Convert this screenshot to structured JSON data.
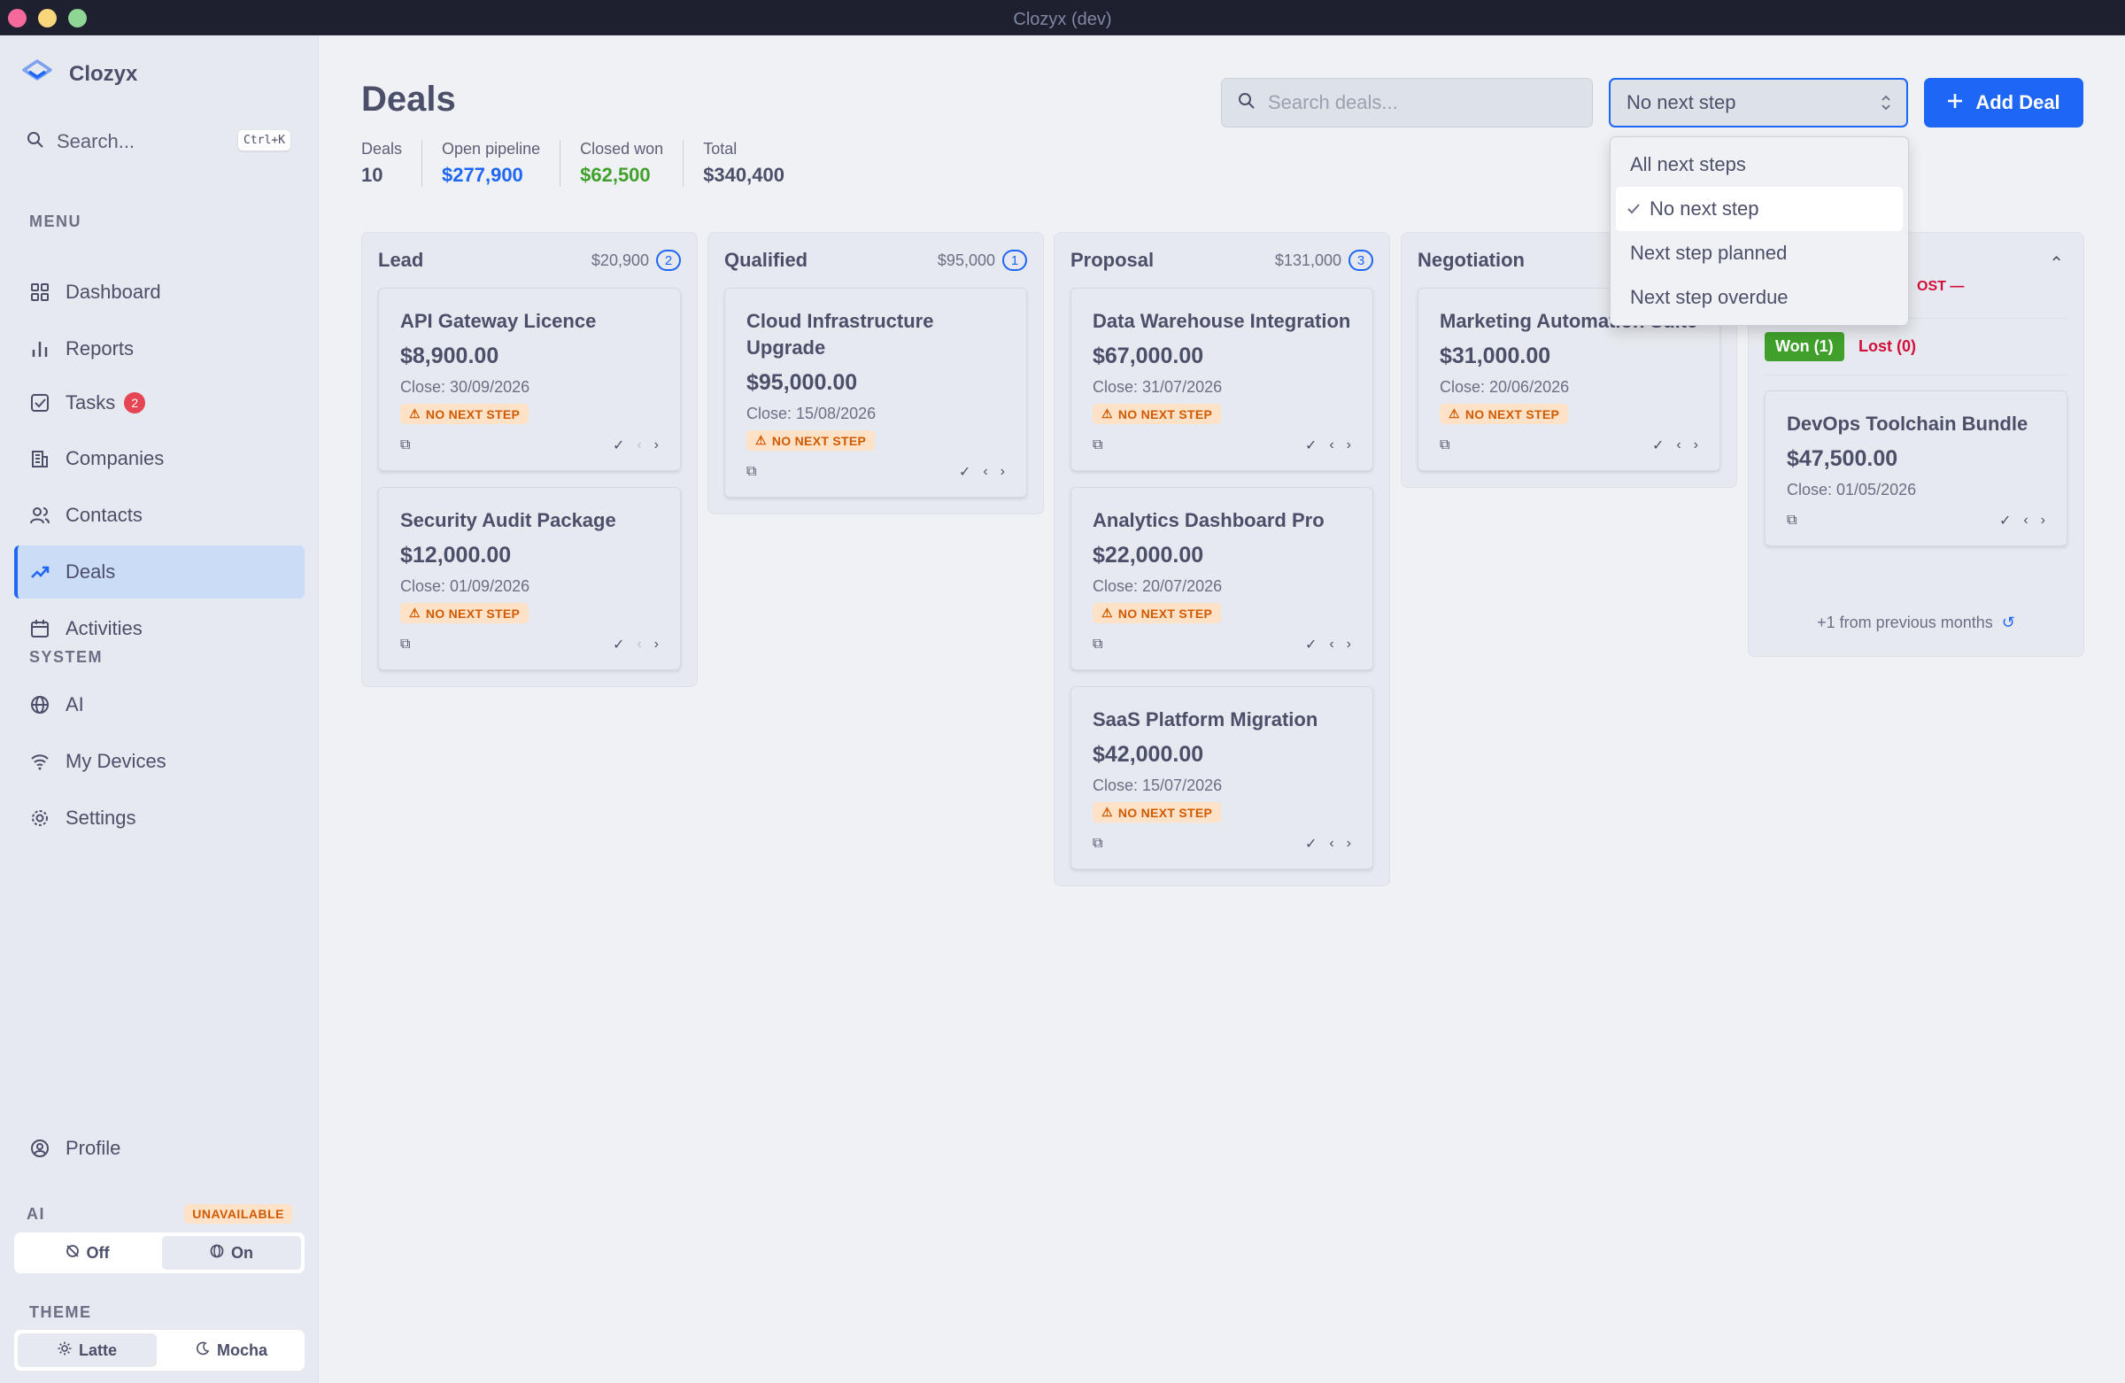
{
  "window": {
    "title": "Clozyx (dev)"
  },
  "sidebar": {
    "app_name": "Clozyx",
    "search_placeholder": "Search...",
    "search_shortcut": "Ctrl+K",
    "menu_label": "MENU",
    "system_label": "SYSTEM",
    "items": [
      {
        "label": "Dashboard",
        "icon": "dashboard-icon"
      },
      {
        "label": "Reports",
        "icon": "bar-chart-icon"
      },
      {
        "label": "Tasks",
        "icon": "checkbox-icon",
        "badge": "2"
      },
      {
        "label": "Companies",
        "icon": "building-icon"
      },
      {
        "label": "Contacts",
        "icon": "users-icon"
      },
      {
        "label": "Deals",
        "icon": "trending-up-icon",
        "active": true
      },
      {
        "label": "Activities",
        "icon": "calendar-icon"
      }
    ],
    "system_items": [
      {
        "label": "AI",
        "icon": "globe-icon"
      },
      {
        "label": "My Devices",
        "icon": "wifi-icon"
      },
      {
        "label": "Settings",
        "icon": "gear-icon"
      }
    ],
    "profile": {
      "label": "Profile",
      "icon": "user-circle-icon"
    },
    "ai": {
      "label": "AI",
      "status": "UNAVAILABLE",
      "off": "Off",
      "on": "On"
    },
    "theme": {
      "label": "THEME",
      "latte": "Latte",
      "mocha": "Mocha"
    }
  },
  "header": {
    "title": "Deals",
    "search_placeholder": "Search deals...",
    "filter_value": "No next step",
    "add_button": "Add Deal"
  },
  "stats": [
    {
      "label": "Deals",
      "value": "10",
      "color": "#4c4f69"
    },
    {
      "label": "Open pipeline",
      "value": "$277,900",
      "color": "#1e66f5"
    },
    {
      "label": "Closed won",
      "value": "$62,500",
      "color": "#40a02b"
    },
    {
      "label": "Total",
      "value": "$340,400",
      "color": "#4c4f69"
    }
  ],
  "columns": [
    {
      "title": "Lead",
      "total": "$20,900",
      "count": "2",
      "cards": [
        {
          "name": "API Gateway Licence",
          "amount": "$8,900.00",
          "close": "Close: 30/09/2026",
          "flag": "NO NEXT STEP"
        },
        {
          "name": "Security Audit Package",
          "amount": "$12,000.00",
          "close": "Close: 01/09/2026",
          "flag": "NO NEXT STEP"
        }
      ]
    },
    {
      "title": "Qualified",
      "total": "$95,000",
      "count": "1",
      "cards": [
        {
          "name": "Cloud Infrastructure Upgrade",
          "amount": "$95,000.00",
          "close": "Close: 15/08/2026",
          "flag": "NO NEXT STEP"
        }
      ]
    },
    {
      "title": "Proposal",
      "total": "$131,000",
      "count": "3",
      "cards": [
        {
          "name": "Data Warehouse Integration",
          "amount": "$67,000.00",
          "close": "Close: 31/07/2026",
          "flag": "NO NEXT STEP"
        },
        {
          "name": "Analytics Dashboard Pro",
          "amount": "$22,000.00",
          "close": "Close: 20/07/2026",
          "flag": "NO NEXT STEP"
        },
        {
          "name": "SaaS Platform Migration",
          "amount": "$42,000.00",
          "close": "Close: 15/07/2026",
          "flag": "NO NEXT STEP"
        }
      ]
    },
    {
      "title": "Negotiation",
      "cards": [
        {
          "name": "Marketing Automation Suite",
          "amount": "$31,000.00",
          "close": "Close: 20/06/2026",
          "flag": "NO NEXT STEP"
        }
      ]
    }
  ],
  "closed": {
    "lost_header": "OST —",
    "won_tab": "Won (1)",
    "lost_tab": "Lost (0)",
    "card": {
      "name": "DevOps Toolchain Bundle",
      "amount": "$47,500.00",
      "close": "Close: 01/05/2026"
    },
    "previous": "+1 from previous months"
  },
  "dropdown": {
    "options": [
      "All next steps",
      "No next step",
      "Next step planned",
      "Next step overdue"
    ],
    "selected": "No next step"
  }
}
